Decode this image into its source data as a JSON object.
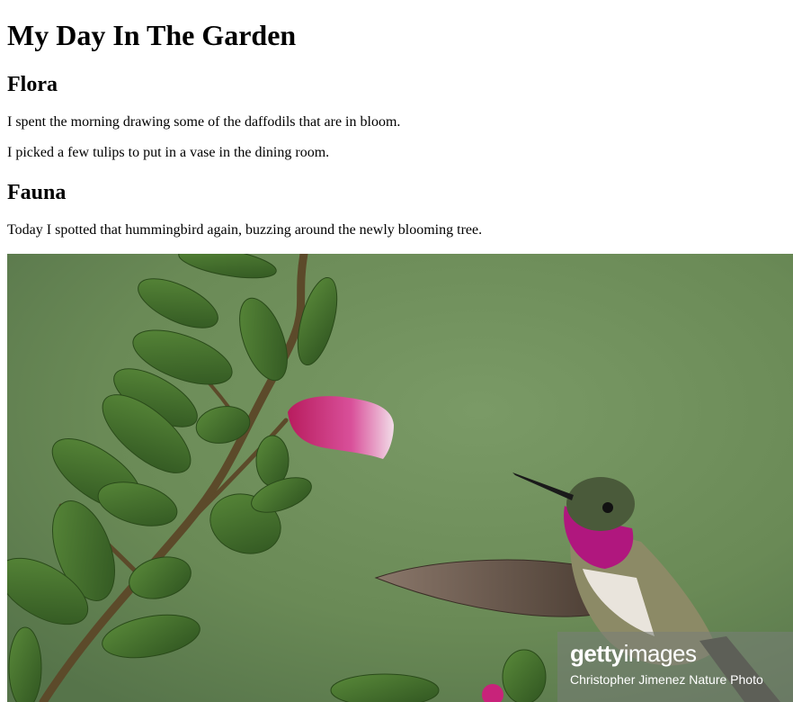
{
  "page": {
    "title": "My Day In The Garden"
  },
  "flora": {
    "heading": "Flora",
    "paragraphs": [
      "I spent the morning drawing some of the daffodils that are in bloom.",
      "I picked a few tulips to put in a vase in the dining room."
    ]
  },
  "fauna": {
    "heading": "Fauna",
    "paragraphs": [
      "Today I spotted that hummingbird again, buzzing around the newly blooming tree."
    ]
  },
  "photo": {
    "watermark_brand_bold": "getty",
    "watermark_brand_light": "images",
    "watermark_credit": "Christopher Jimenez Nature Photo",
    "colors": {
      "background": "#6f8d5b",
      "leaf": "#3f6a2c",
      "flower": "#c8237a",
      "bird_throat": "#b0177e"
    }
  }
}
